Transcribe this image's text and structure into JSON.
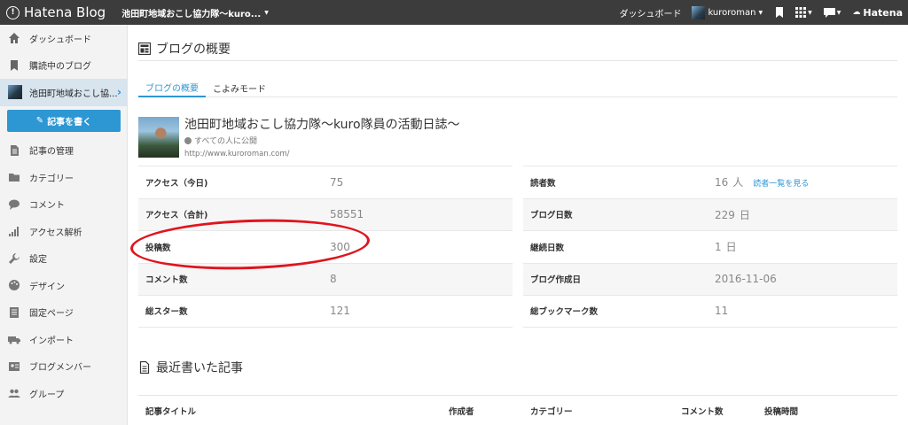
{
  "topbar": {
    "logo_text": "Hatena Blog",
    "blog_switch": "池田町地域おこし協力隊〜kuro...",
    "dashboard_link": "ダッシュボード",
    "username": "kuroroman",
    "brand": "Hatena"
  },
  "sidebar": {
    "items": [
      {
        "label": "ダッシュボード",
        "icon": "home-icon"
      },
      {
        "label": "購読中のブログ",
        "icon": "bookmark-icon"
      },
      {
        "label": "池田町地域おこし協...",
        "icon": "blog-avatar"
      },
      {
        "label": "記事の管理",
        "icon": "document-icon"
      },
      {
        "label": "カテゴリー",
        "icon": "folder-icon"
      },
      {
        "label": "コメント",
        "icon": "comment-icon"
      },
      {
        "label": "アクセス解析",
        "icon": "bar-chart-icon"
      },
      {
        "label": "設定",
        "icon": "wrench-icon"
      },
      {
        "label": "デザイン",
        "icon": "palette-icon"
      },
      {
        "label": "固定ページ",
        "icon": "page-icon"
      },
      {
        "label": "インポート",
        "icon": "truck-icon"
      },
      {
        "label": "ブログメンバー",
        "icon": "member-icon"
      },
      {
        "label": "グループ",
        "icon": "group-icon"
      }
    ],
    "write_button": "記事を書く"
  },
  "main": {
    "section_title": "ブログの概要",
    "tabs": [
      {
        "label": "ブログの概要",
        "active": true
      },
      {
        "label": "こよみモード",
        "active": false
      }
    ],
    "blog": {
      "title": "池田町地域おこし協力隊〜kuro隊員の活動日誌〜",
      "visibility": "すべての人に公開",
      "url": "http://www.kuroroman.com/"
    },
    "stats_left": [
      {
        "label": "アクセス（今日)",
        "value": "75"
      },
      {
        "label": "アクセス（合計)",
        "value": "58551"
      },
      {
        "label": "投稿数",
        "value": "300"
      },
      {
        "label": "コメント数",
        "value": "8"
      },
      {
        "label": "総スター数",
        "value": "121"
      }
    ],
    "stats_right": [
      {
        "label": "読者数",
        "value": "16",
        "unit": "人",
        "link": "読者一覧を見る"
      },
      {
        "label": "ブログ日数",
        "value": "229",
        "unit": "日"
      },
      {
        "label": "継続日数",
        "value": "1",
        "unit": "日"
      },
      {
        "label": "ブログ作成日",
        "value": "2016-11-06"
      },
      {
        "label": "総ブックマーク数",
        "value": "11"
      }
    ],
    "recent_title": "最近書いた記事",
    "table_headers": {
      "title": "記事タイトル",
      "author": "作成者",
      "category": "カテゴリー",
      "comments": "コメント数",
      "posted": "投稿時間"
    }
  },
  "colors": {
    "topbar_bg": "#3c3c3c",
    "accent": "#2d97d4",
    "annotation_red": "#e0141e"
  }
}
